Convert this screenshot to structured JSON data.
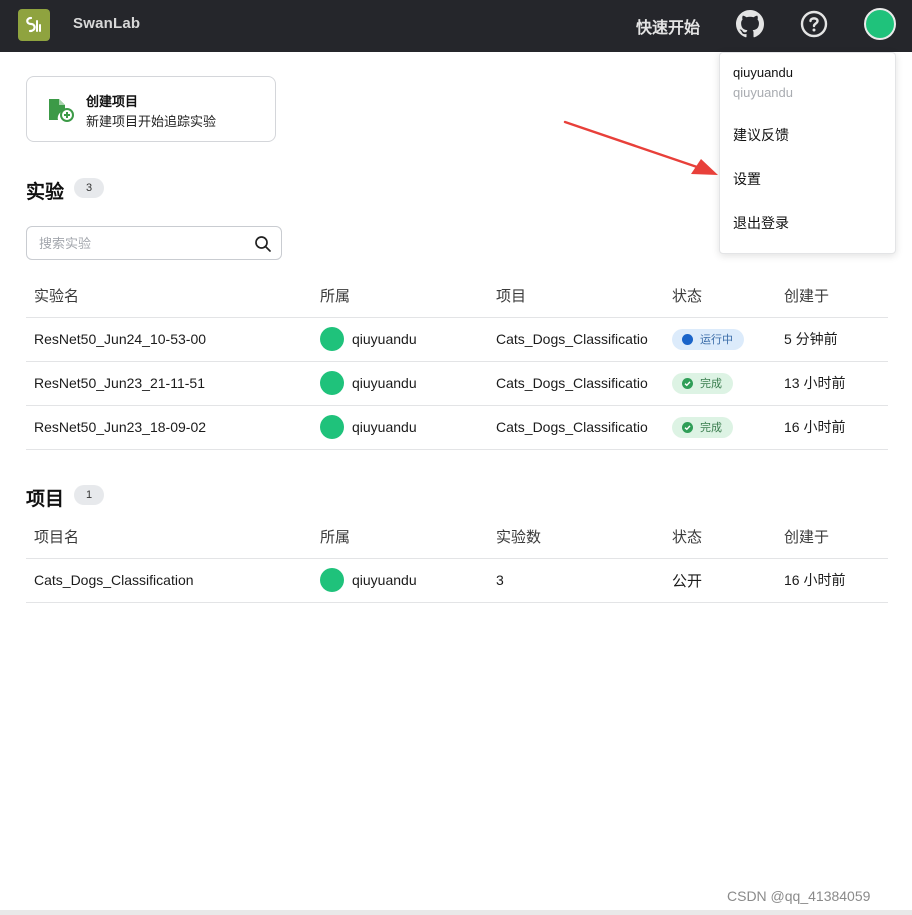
{
  "app": {
    "brand": "SwanLab"
  },
  "header": {
    "quickstart": "快速开始"
  },
  "user_menu": {
    "username": "qiuyuandu",
    "subtitle": "qiuyuandu",
    "items": [
      "建议反馈",
      "设置",
      "退出登录"
    ]
  },
  "create_project": {
    "title": "创建项目",
    "subtitle": "新建项目开始追踪实验"
  },
  "experiments": {
    "title": "实验",
    "count": "3",
    "search_placeholder": "搜索实验",
    "columns": [
      "实验名",
      "所属",
      "项目",
      "状态",
      "创建于"
    ],
    "rows": [
      {
        "name": "ResNet50_Jun24_10-53-00",
        "owner": "qiuyuandu",
        "project": "Cats_Dogs_Classificatio",
        "status": "运行中",
        "created": "5 分钟前"
      },
      {
        "name": "ResNet50_Jun23_21-11-51",
        "owner": "qiuyuandu",
        "project": "Cats_Dogs_Classificatio",
        "status": "完成",
        "created": "13 小时前"
      },
      {
        "name": "ResNet50_Jun23_18-09-02",
        "owner": "qiuyuandu",
        "project": "Cats_Dogs_Classificatio",
        "status": "完成",
        "created": "16 小时前"
      }
    ]
  },
  "projects": {
    "title": "项目",
    "count": "1",
    "columns": [
      "项目名",
      "所属",
      "实验数",
      "状态",
      "创建于"
    ],
    "rows": [
      {
        "name": "Cats_Dogs_Classification",
        "owner": "qiuyuandu",
        "count": "3",
        "visibility": "公开",
        "created": "16 小时前"
      }
    ]
  },
  "watermark": "CSDN @qq_41384059",
  "colors": {
    "topbar": "#25262b",
    "logo": "#8fa33f",
    "avatar": "#1fc27b",
    "annotation_arrow": "#e8403a"
  },
  "icons": [
    "swanlab-logo-icon",
    "github-icon",
    "help-icon",
    "new-project-icon",
    "search-icon",
    "arrow-annotation"
  ]
}
